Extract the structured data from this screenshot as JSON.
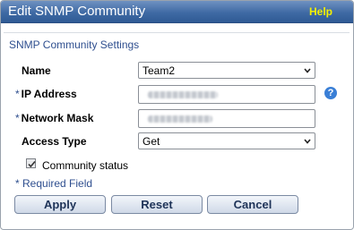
{
  "dialog": {
    "title": "Edit SNMP Community",
    "help_label": "Help"
  },
  "section": {
    "title": "SNMP Community Settings"
  },
  "fields": {
    "name": {
      "label": "Name",
      "value": "Team2"
    },
    "ip_address": {
      "required_mark": "*",
      "label": "IP Address",
      "value": "",
      "note": "value obscured"
    },
    "network_mask": {
      "required_mark": "*",
      "label": "Network Mask",
      "value": ""
    },
    "access_type": {
      "label": "Access Type",
      "value": "Get"
    }
  },
  "community_status": {
    "label": "Community status",
    "checked": true
  },
  "required_note": "* Required Field",
  "buttons": {
    "apply": "Apply",
    "reset": "Reset",
    "cancel": "Cancel"
  },
  "icons": {
    "info": "info-icon",
    "dropdown": "chevron-down-icon",
    "checkbox": "checkmark-icon"
  },
  "colors": {
    "titlebar": "#3f6aa4",
    "help": "#f4f000",
    "accent_text": "#2f4f8f",
    "info_icon": "#3a7fd6"
  }
}
